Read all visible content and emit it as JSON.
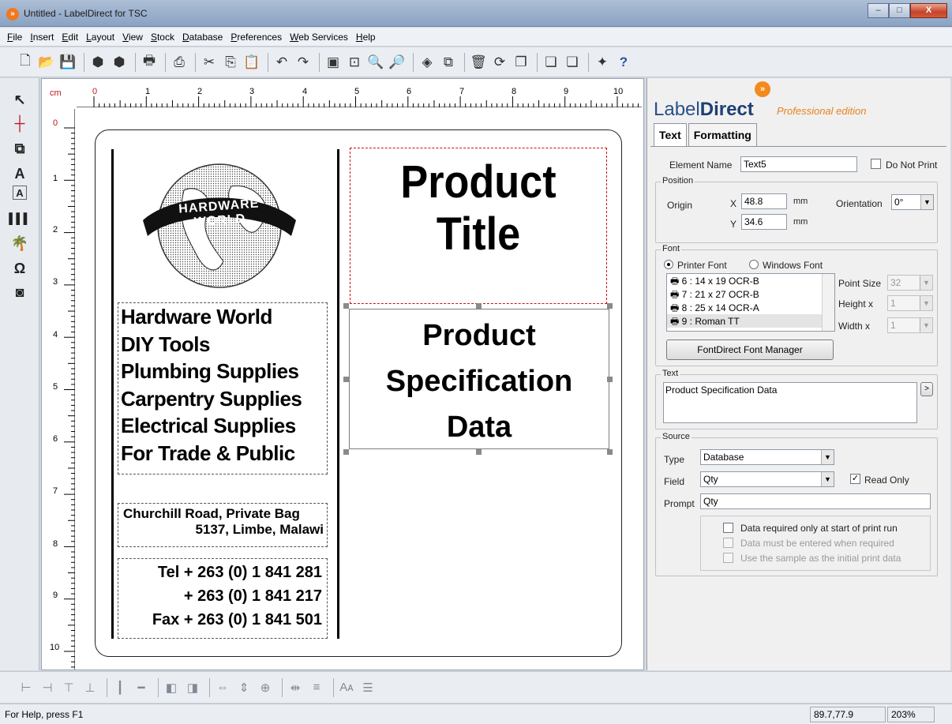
{
  "window": {
    "title": "Untitled - LabelDirect for TSC",
    "minimize": "–",
    "maximize": "□",
    "close": "X"
  },
  "menu": [
    "File",
    "Insert",
    "Edit",
    "Layout",
    "View",
    "Stock",
    "Database",
    "Preferences",
    "Web Services",
    "Help"
  ],
  "ruler": {
    "unit": "cm",
    "h_ticks": [
      "0",
      "1",
      "2",
      "3",
      "4",
      "5",
      "6",
      "7",
      "8",
      "9",
      "10"
    ],
    "v_ticks": [
      "0",
      "1",
      "2",
      "3",
      "4",
      "5",
      "6",
      "7",
      "8",
      "9",
      "10"
    ]
  },
  "label": {
    "product_title_line1": "Product",
    "product_title_line2": "Title",
    "spec_line1": "Product",
    "spec_line2": "Specification",
    "spec_line3": "Data",
    "globe_text": "HARDWARE WORLD",
    "services": [
      "Hardware World",
      "DIY Tools",
      "Plumbing Supplies",
      "Carpentry Supplies",
      "Electrical Supplies",
      "For Trade & Public"
    ],
    "address_line1": "Churchill Road, Private Bag",
    "address_line2": "5137, Limbe, Malawi",
    "tel_label": "Tel",
    "tel1": "+ 263 (0) 1 841 281",
    "tel2": "+ 263 (0) 1 841 217",
    "fax_label": "Fax",
    "fax": "+ 263 (0) 1 841 501"
  },
  "panel": {
    "logo_label": "Label",
    "logo_direct": "Direct",
    "logo_mark": "»",
    "edition": "Professional edition",
    "tabs": [
      "Text",
      "Formatting"
    ],
    "element_name_label": "Element Name",
    "element_name": "Text5",
    "do_not_print": "Do Not Print",
    "position_legend": "Position",
    "origin_label": "Origin",
    "x_label": "X",
    "x_value": "48.8",
    "y_label": "Y",
    "y_value": "34.6",
    "mm1": "mm",
    "mm2": "mm",
    "orientation_label": "Orientation",
    "orientation_value": "0°",
    "font_legend": "Font",
    "printer_font": "Printer Font",
    "windows_font": "Windows Font",
    "font_list": [
      "6 : 14 x 19 OCR-B",
      "7 : 21 x 27 OCR-B",
      "8 : 25 x 14 OCR-A",
      "9 : Roman TT"
    ],
    "point_size_label": "Point Size",
    "point_size_value": "32",
    "height_label": "Height x",
    "height_value": "1",
    "width_label": "Width x",
    "width_value": "1",
    "font_manager_button": "FontDirect Font Manager",
    "text_legend": "Text",
    "text_value": "Product Specification Data",
    "text_expand": ">",
    "source_legend": "Source",
    "type_label": "Type",
    "type_value": "Database",
    "field_label": "Field",
    "field_value": "Qty",
    "read_only": "Read Only",
    "prompt_label": "Prompt",
    "prompt_value": "Qty",
    "opt1": "Data required only at start of print run",
    "opt2": "Data must be entered when required",
    "opt3": "Use the sample as the initial print data"
  },
  "status": {
    "help": "For Help, press F1",
    "coords": "89.7,77.9",
    "zoom": "203%"
  }
}
